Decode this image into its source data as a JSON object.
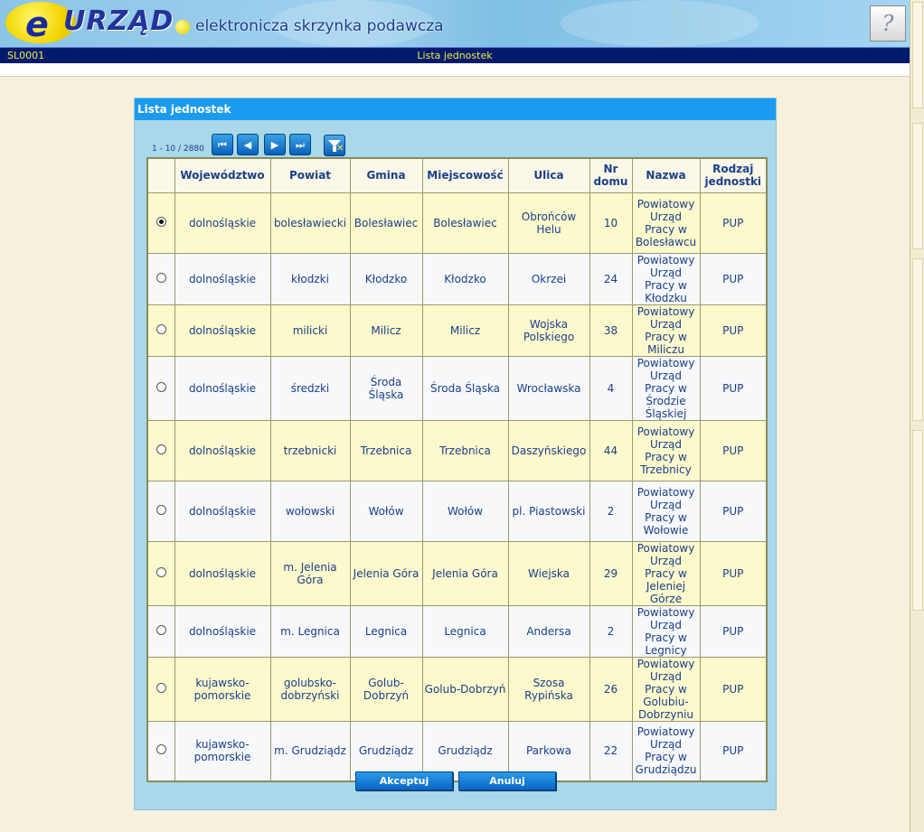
{
  "header": {
    "logo_mark": "e",
    "logo_text": "URZĄD",
    "logo_subtitle": "elektronicza skrzynka podawcza",
    "help_icon": "?"
  },
  "statusbar": {
    "code": "SL0001",
    "title": "Lista jednostek"
  },
  "panel": {
    "title": "Lista jednostek",
    "pager_count": "1 - 10 / 2880",
    "nav_icons": [
      "first-page-icon",
      "prev-page-icon",
      "next-page-icon",
      "last-page-icon",
      "clear-filter-icon"
    ],
    "nav_glyphs": {
      "first": "⏮",
      "prev": "◀",
      "next": "▶",
      "last": "⏭"
    }
  },
  "table": {
    "columns": [
      "Województwo",
      "Powiat",
      "Gmina",
      "Miejscowość",
      "Ulica",
      "Nr domu",
      "Nazwa",
      "Rodzaj jednostki"
    ],
    "rows": [
      {
        "selected": true,
        "wojewodztwo": "dolnośląskie",
        "powiat": "bolesławiecki",
        "gmina": "Bolesławiec",
        "miejscowosc": "Bolesławiec",
        "ulica": "Obrońców Helu",
        "nr": "10",
        "nazwa": "Powiatowy Urząd Pracy w Bolesławcu",
        "rodzaj": "PUP"
      },
      {
        "selected": false,
        "wojewodztwo": "dolnośląskie",
        "powiat": "kłodzki",
        "gmina": "Kłodzko",
        "miejscowosc": "Kłodzko",
        "ulica": "Okrzei",
        "nr": "24",
        "nazwa": "Powiatowy Urząd Pracy w Kłodzku",
        "rodzaj": "PUP"
      },
      {
        "selected": false,
        "wojewodztwo": "dolnośląskie",
        "powiat": "milicki",
        "gmina": "Milicz",
        "miejscowosc": "Milicz",
        "ulica": "Wojska Polskiego",
        "nr": "38",
        "nazwa": "Powiatowy Urząd Pracy w Miliczu",
        "rodzaj": "PUP"
      },
      {
        "selected": false,
        "wojewodztwo": "dolnośląskie",
        "powiat": "średzki",
        "gmina": "Środa Śląska",
        "miejscowosc": "Środa Śląska",
        "ulica": "Wrocławska",
        "nr": "4",
        "nazwa": "Powiatowy Urząd Pracy w Środzie Śląskiej",
        "rodzaj": "PUP"
      },
      {
        "selected": false,
        "wojewodztwo": "dolnośląskie",
        "powiat": "trzebnicki",
        "gmina": "Trzebnica",
        "miejscowosc": "Trzebnica",
        "ulica": "Daszyńskiego",
        "nr": "44",
        "nazwa": "Powiatowy Urząd Pracy w Trzebnicy",
        "rodzaj": "PUP"
      },
      {
        "selected": false,
        "wojewodztwo": "dolnośląskie",
        "powiat": "wołowski",
        "gmina": "Wołów",
        "miejscowosc": "Wołów",
        "ulica": "pl. Piastowski",
        "nr": "2",
        "nazwa": "Powiatowy Urząd Pracy w Wołowie",
        "rodzaj": "PUP"
      },
      {
        "selected": false,
        "wojewodztwo": "dolnośląskie",
        "powiat": "m. Jelenia Góra",
        "gmina": "Jelenia Góra",
        "miejscowosc": "Jelenia Góra",
        "ulica": "Wiejska",
        "nr": "29",
        "nazwa": "Powiatowy Urząd Pracy w Jeleniej Górze",
        "rodzaj": "PUP"
      },
      {
        "selected": false,
        "wojewodztwo": "dolnośląskie",
        "powiat": "m. Legnica",
        "gmina": "Legnica",
        "miejscowosc": "Legnica",
        "ulica": "Andersa",
        "nr": "2",
        "nazwa": "Powiatowy Urząd Pracy w Legnicy",
        "rodzaj": "PUP"
      },
      {
        "selected": false,
        "wojewodztwo": "kujawsko-pomorskie",
        "powiat": "golubsko-dobrzyński",
        "gmina": "Golub-Dobrzyń",
        "miejscowosc": "Golub-Dobrzyń",
        "ulica": "Szosa Rypińska",
        "nr": "26",
        "nazwa": "Powiatowy Urząd Pracy w Golubiu-Dobrzyniu",
        "rodzaj": "PUP"
      },
      {
        "selected": false,
        "wojewodztwo": "kujawsko-pomorskie",
        "powiat": "m. Grudziądz",
        "gmina": "Grudziądz",
        "miejscowosc": "Grudziądz",
        "ulica": "Parkowa",
        "nr": "22",
        "nazwa": "Powiatowy Urząd Pracy w Grudziądzu",
        "rodzaj": "PUP"
      }
    ]
  },
  "buttons": {
    "accept_label": "Akceptuj",
    "cancel_label": "Anuluj"
  },
  "colors": {
    "panel_header": "#1b9bf0",
    "panel_bg": "#a8d8ea",
    "row_odd": "#fcf9cc",
    "row_even": "#f6f8fa",
    "text": "#1b3f8a",
    "statusbar_bg": "#001b6e",
    "statusbar_text": "#f5e94a"
  }
}
